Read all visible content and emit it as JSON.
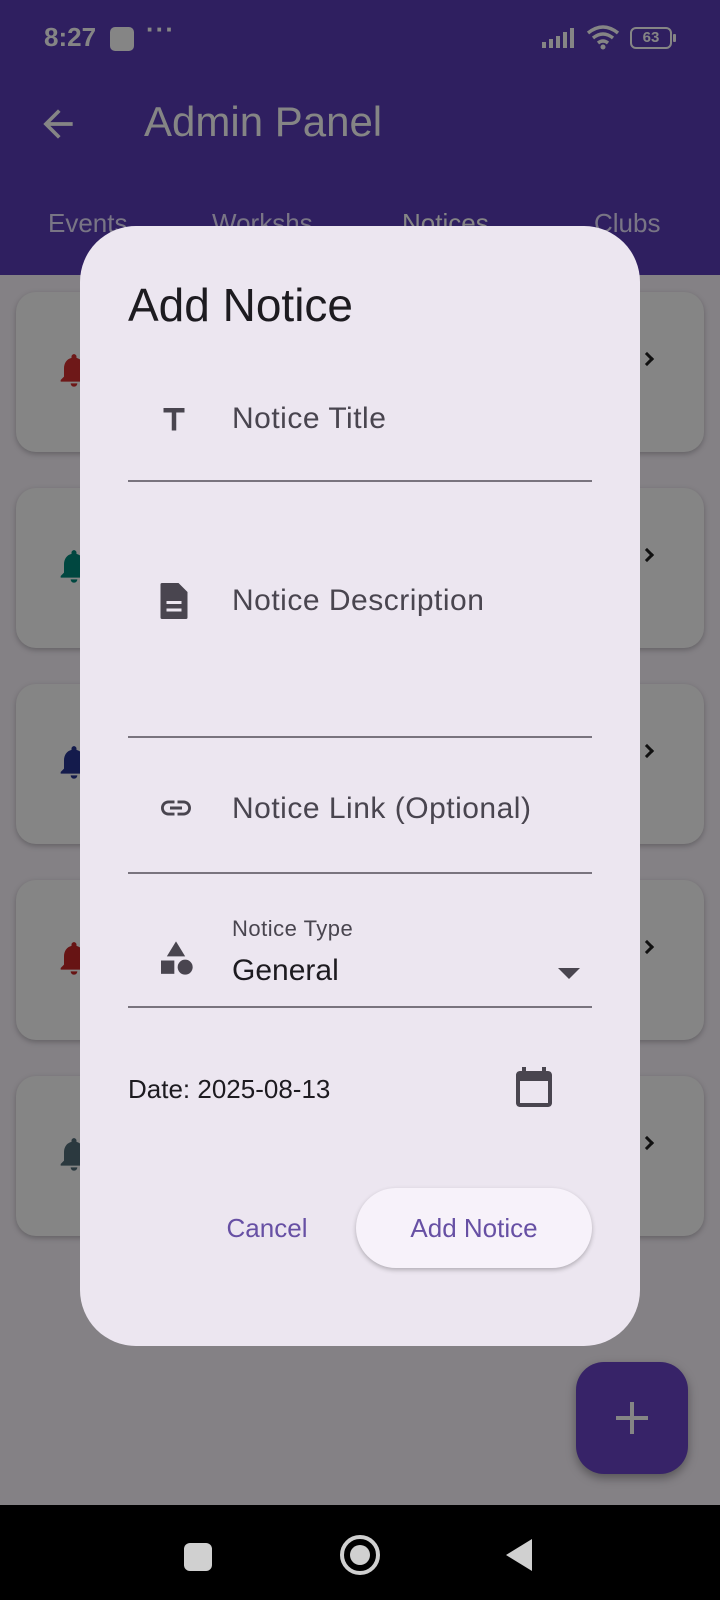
{
  "status_bar": {
    "time": "8:27",
    "battery": "63"
  },
  "app_bar": {
    "title": "Admin Panel",
    "tabs": [
      "Events",
      "Workshs",
      "Notices",
      "Clubs"
    ]
  },
  "notice_list": {
    "bell_colors": [
      "#d32f2f",
      "#00897b",
      "#283593",
      "#c62828",
      "#546e7a"
    ]
  },
  "dialog": {
    "title": "Add Notice",
    "title_field": {
      "placeholder": "Notice Title",
      "icon": "title-icon"
    },
    "description_field": {
      "placeholder": "Notice Description",
      "icon": "description-icon"
    },
    "link_field": {
      "placeholder": "Notice Link (Optional)",
      "icon": "link-icon"
    },
    "type_field": {
      "label": "Notice Type",
      "value": "General",
      "icon": "category-icon"
    },
    "date_label": "Date: 2025-08-13",
    "buttons": {
      "cancel": "Cancel",
      "add": "Add Notice"
    }
  },
  "colors": {
    "primary": "#6750a4",
    "app_bar": "#5a3db8",
    "dialog_surface": "#ece6f0"
  }
}
